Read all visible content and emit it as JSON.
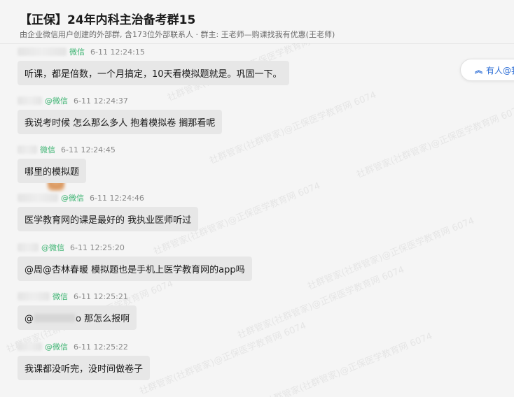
{
  "header": {
    "title": "【正保】24年内科主治备考群15",
    "subtitle": "由企业微信用户创建的外部群, 含173位外部联系人 · 群主: 王老师—购课找我有优惠(王老师)"
  },
  "float_button": {
    "label": "有人@我",
    "icon": "double-chevron-up-icon"
  },
  "watermark_text": "社群管家(社群管家)@正保医学教育网 6074",
  "messages": [
    {
      "source": "微信",
      "time": "6-11 12:24:15",
      "text": "听课，都是倍数，一个月搞定，10天看模拟题就是。巩固一下。"
    },
    {
      "source": "@微信",
      "time": "6-11 12:24:37",
      "text": "我说考时候 怎么那么多人 抱着模拟卷 搁那看呢"
    },
    {
      "source": "微信",
      "time": "6-11 12:24:45",
      "text": "哪里的模拟题"
    },
    {
      "source": "@微信",
      "time": "6-11 12:24:46",
      "text": "医学教育网的课是最好的 我执业医师听过"
    },
    {
      "source": "@微信",
      "time": "6-11 12:25:20",
      "text": "@周@杏林春暖 模拟题也是手机上医学教育网的app吗"
    },
    {
      "source": "微信",
      "time": "6-11 12:25:21",
      "text_prefix": "@",
      "text_suffix": "o 那怎么报啊"
    },
    {
      "source": "@微信",
      "time": "6-11 12:25:22",
      "text": "我课都没听完，没时间做卷子"
    }
  ]
}
